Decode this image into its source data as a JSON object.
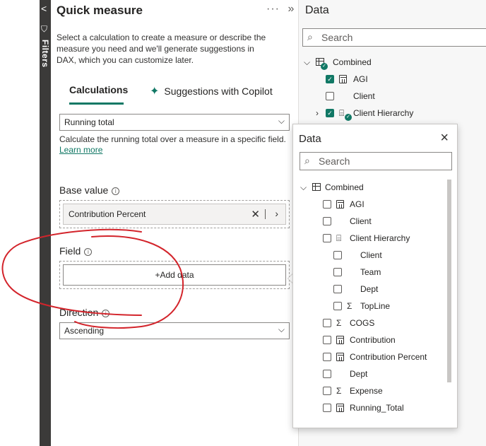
{
  "filters_pane": {
    "label": "Filters"
  },
  "quick_measure": {
    "title": "Quick measure",
    "more_label": "···",
    "collapse_label": "»",
    "description": "Select a calculation to create a measure or describe the measure you need and we'll generate suggestions in DAX, which you can customize later.",
    "tabs": [
      {
        "label": "Calculations",
        "active": true
      },
      {
        "label": "Suggestions with Copilot",
        "active": false
      }
    ],
    "calculation": {
      "value": "Running total",
      "help": "Calculate the running total over a measure in a specific field.",
      "learn_more": "Learn more"
    },
    "base_value": {
      "label": "Base value",
      "value": "Contribution Percent"
    },
    "field": {
      "label": "Field",
      "add_label": "+Add data"
    },
    "direction": {
      "label": "Direction",
      "value": "Ascending"
    }
  },
  "data_pane": {
    "title": "Data",
    "search_placeholder": "Search",
    "items": [
      {
        "label": "Combined",
        "type": "table",
        "expanded": true
      },
      {
        "label": "AGI",
        "type": "measure",
        "checked": true
      },
      {
        "label": "Client",
        "type": "field",
        "checked": false
      },
      {
        "label": "Client Hierarchy",
        "type": "hierarchy",
        "checked": true
      }
    ]
  },
  "popup": {
    "title": "Data",
    "close_label": "×",
    "search_placeholder": "Search",
    "items": [
      {
        "label": "Combined",
        "type": "table"
      },
      {
        "label": "AGI",
        "type": "measure"
      },
      {
        "label": "Client",
        "type": "field"
      },
      {
        "label": "Client Hierarchy",
        "type": "hierarchy"
      },
      {
        "label": "Client",
        "type": "field"
      },
      {
        "label": "Team",
        "type": "field"
      },
      {
        "label": "Dept",
        "type": "field"
      },
      {
        "label": "TopLine",
        "type": "sum"
      },
      {
        "label": "COGS",
        "type": "sum"
      },
      {
        "label": "Contribution",
        "type": "measure"
      },
      {
        "label": "Contribution Percent",
        "type": "measure"
      },
      {
        "label": "Dept",
        "type": "field"
      },
      {
        "label": "Expense",
        "type": "sum"
      },
      {
        "label": "Running_Total",
        "type": "measure"
      }
    ]
  },
  "colors": {
    "accent": "#117865",
    "annotation": "#d3242b"
  }
}
